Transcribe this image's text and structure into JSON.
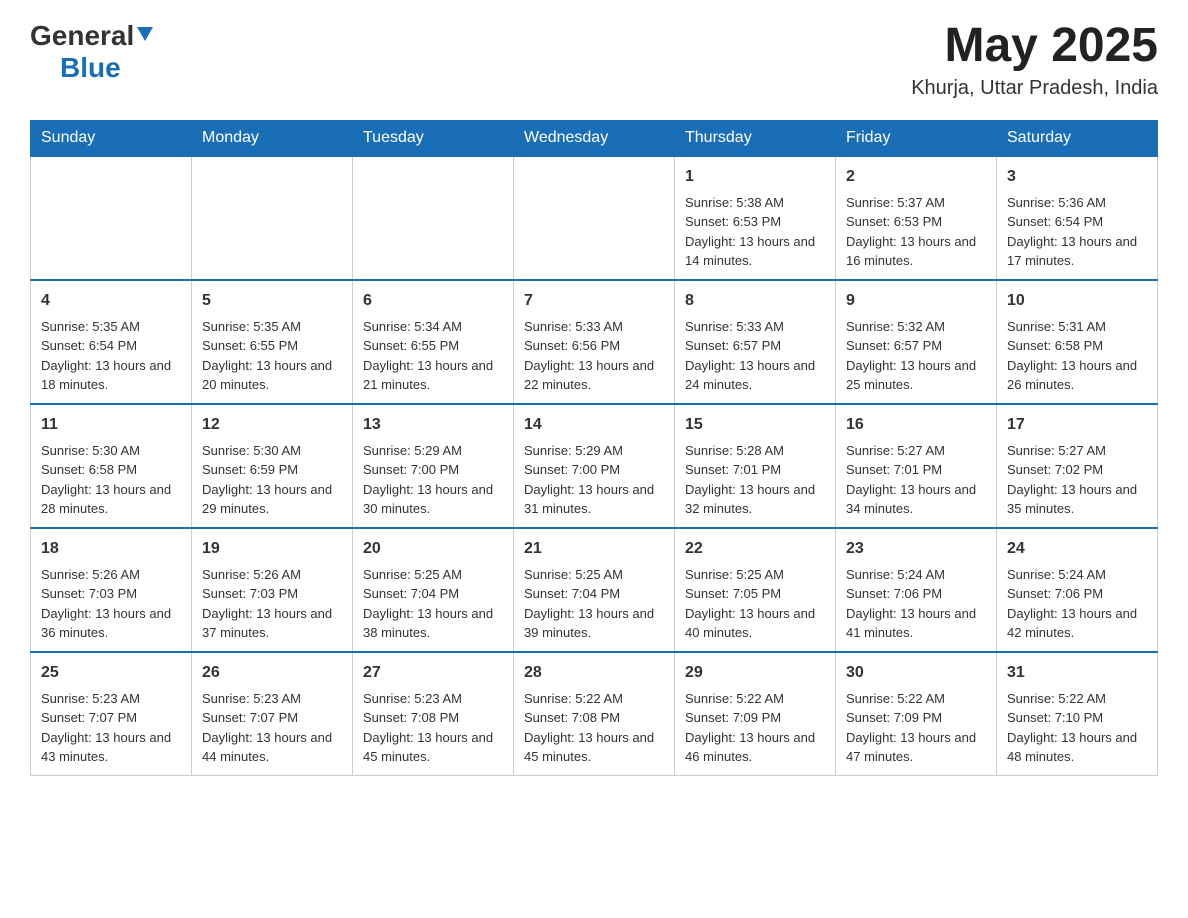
{
  "header": {
    "logo_general": "General",
    "logo_blue": "Blue",
    "month_year": "May 2025",
    "location": "Khurja, Uttar Pradesh, India"
  },
  "days_of_week": [
    "Sunday",
    "Monday",
    "Tuesday",
    "Wednesday",
    "Thursday",
    "Friday",
    "Saturday"
  ],
  "weeks": [
    [
      {
        "day": "",
        "info": ""
      },
      {
        "day": "",
        "info": ""
      },
      {
        "day": "",
        "info": ""
      },
      {
        "day": "",
        "info": ""
      },
      {
        "day": "1",
        "info": "Sunrise: 5:38 AM\nSunset: 6:53 PM\nDaylight: 13 hours and 14 minutes."
      },
      {
        "day": "2",
        "info": "Sunrise: 5:37 AM\nSunset: 6:53 PM\nDaylight: 13 hours and 16 minutes."
      },
      {
        "day": "3",
        "info": "Sunrise: 5:36 AM\nSunset: 6:54 PM\nDaylight: 13 hours and 17 minutes."
      }
    ],
    [
      {
        "day": "4",
        "info": "Sunrise: 5:35 AM\nSunset: 6:54 PM\nDaylight: 13 hours and 18 minutes."
      },
      {
        "day": "5",
        "info": "Sunrise: 5:35 AM\nSunset: 6:55 PM\nDaylight: 13 hours and 20 minutes."
      },
      {
        "day": "6",
        "info": "Sunrise: 5:34 AM\nSunset: 6:55 PM\nDaylight: 13 hours and 21 minutes."
      },
      {
        "day": "7",
        "info": "Sunrise: 5:33 AM\nSunset: 6:56 PM\nDaylight: 13 hours and 22 minutes."
      },
      {
        "day": "8",
        "info": "Sunrise: 5:33 AM\nSunset: 6:57 PM\nDaylight: 13 hours and 24 minutes."
      },
      {
        "day": "9",
        "info": "Sunrise: 5:32 AM\nSunset: 6:57 PM\nDaylight: 13 hours and 25 minutes."
      },
      {
        "day": "10",
        "info": "Sunrise: 5:31 AM\nSunset: 6:58 PM\nDaylight: 13 hours and 26 minutes."
      }
    ],
    [
      {
        "day": "11",
        "info": "Sunrise: 5:30 AM\nSunset: 6:58 PM\nDaylight: 13 hours and 28 minutes."
      },
      {
        "day": "12",
        "info": "Sunrise: 5:30 AM\nSunset: 6:59 PM\nDaylight: 13 hours and 29 minutes."
      },
      {
        "day": "13",
        "info": "Sunrise: 5:29 AM\nSunset: 7:00 PM\nDaylight: 13 hours and 30 minutes."
      },
      {
        "day": "14",
        "info": "Sunrise: 5:29 AM\nSunset: 7:00 PM\nDaylight: 13 hours and 31 minutes."
      },
      {
        "day": "15",
        "info": "Sunrise: 5:28 AM\nSunset: 7:01 PM\nDaylight: 13 hours and 32 minutes."
      },
      {
        "day": "16",
        "info": "Sunrise: 5:27 AM\nSunset: 7:01 PM\nDaylight: 13 hours and 34 minutes."
      },
      {
        "day": "17",
        "info": "Sunrise: 5:27 AM\nSunset: 7:02 PM\nDaylight: 13 hours and 35 minutes."
      }
    ],
    [
      {
        "day": "18",
        "info": "Sunrise: 5:26 AM\nSunset: 7:03 PM\nDaylight: 13 hours and 36 minutes."
      },
      {
        "day": "19",
        "info": "Sunrise: 5:26 AM\nSunset: 7:03 PM\nDaylight: 13 hours and 37 minutes."
      },
      {
        "day": "20",
        "info": "Sunrise: 5:25 AM\nSunset: 7:04 PM\nDaylight: 13 hours and 38 minutes."
      },
      {
        "day": "21",
        "info": "Sunrise: 5:25 AM\nSunset: 7:04 PM\nDaylight: 13 hours and 39 minutes."
      },
      {
        "day": "22",
        "info": "Sunrise: 5:25 AM\nSunset: 7:05 PM\nDaylight: 13 hours and 40 minutes."
      },
      {
        "day": "23",
        "info": "Sunrise: 5:24 AM\nSunset: 7:06 PM\nDaylight: 13 hours and 41 minutes."
      },
      {
        "day": "24",
        "info": "Sunrise: 5:24 AM\nSunset: 7:06 PM\nDaylight: 13 hours and 42 minutes."
      }
    ],
    [
      {
        "day": "25",
        "info": "Sunrise: 5:23 AM\nSunset: 7:07 PM\nDaylight: 13 hours and 43 minutes."
      },
      {
        "day": "26",
        "info": "Sunrise: 5:23 AM\nSunset: 7:07 PM\nDaylight: 13 hours and 44 minutes."
      },
      {
        "day": "27",
        "info": "Sunrise: 5:23 AM\nSunset: 7:08 PM\nDaylight: 13 hours and 45 minutes."
      },
      {
        "day": "28",
        "info": "Sunrise: 5:22 AM\nSunset: 7:08 PM\nDaylight: 13 hours and 45 minutes."
      },
      {
        "day": "29",
        "info": "Sunrise: 5:22 AM\nSunset: 7:09 PM\nDaylight: 13 hours and 46 minutes."
      },
      {
        "day": "30",
        "info": "Sunrise: 5:22 AM\nSunset: 7:09 PM\nDaylight: 13 hours and 47 minutes."
      },
      {
        "day": "31",
        "info": "Sunrise: 5:22 AM\nSunset: 7:10 PM\nDaylight: 13 hours and 48 minutes."
      }
    ]
  ]
}
